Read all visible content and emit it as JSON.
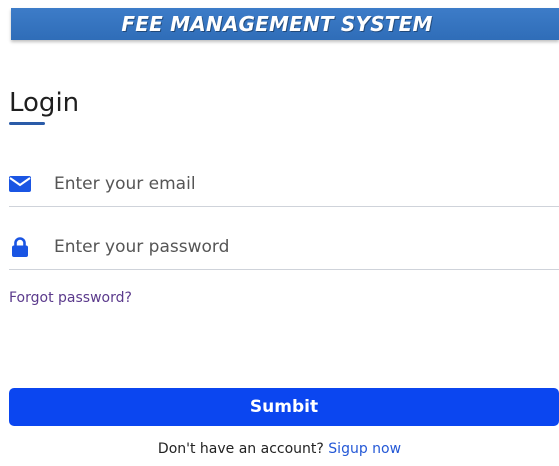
{
  "header": {
    "title": "FEE MANAGEMENT SYSTEM",
    "background": "#3372be"
  },
  "form": {
    "title": "Login",
    "email": {
      "placeholder": "Enter your email",
      "value": "",
      "icon": "envelope-icon"
    },
    "password": {
      "placeholder": "Enter your password",
      "value": "",
      "icon": "lock-icon"
    },
    "forgot_label": "Forgot password?",
    "submit_label": "Sumbit",
    "signup_prompt": "Don't have an account?",
    "signup_link": "Sigup now"
  },
  "colors": {
    "accent": "#0b46f0",
    "icon": "#1a55e3",
    "link": "#2458d6",
    "forgot_link": "#5b3a8c"
  }
}
